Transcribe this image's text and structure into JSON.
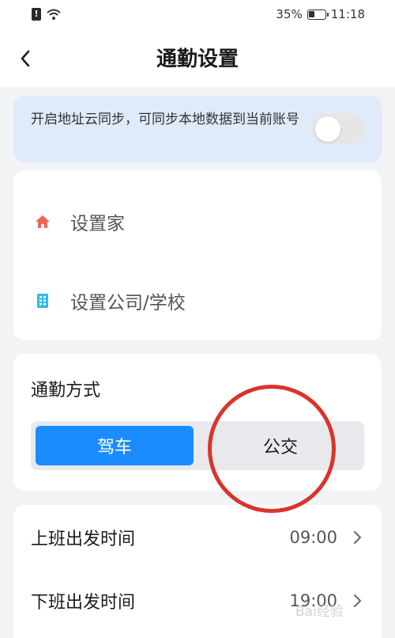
{
  "status_bar": {
    "sim_icon": "sim-alert-icon",
    "wifi_icon": "wifi-icon",
    "battery_percent": "35%",
    "battery_level": 0.35,
    "time": "11:18"
  },
  "header": {
    "back_icon": "chevron-left-icon",
    "title": "通勤设置"
  },
  "sync": {
    "text": "开启地址云同步，可同步本地数据到当前账号",
    "toggle_on": false
  },
  "addresses": {
    "home": {
      "icon": "home-icon",
      "label": "设置家"
    },
    "work": {
      "icon": "building-icon",
      "label": "设置公司/学校"
    }
  },
  "commute": {
    "title": "通勤方式",
    "options": [
      "驾车",
      "公交"
    ],
    "selected": "驾车"
  },
  "times": [
    {
      "label": "上班出发时间",
      "value": "09:00"
    },
    {
      "label": "下班出发时间",
      "value": "19:00"
    }
  ],
  "watermark": "Bai经验",
  "colors": {
    "accent": "#1a8cff",
    "banner_bg": "#dfeafb",
    "annotation": "#d9342b",
    "home_icon": "#f0645a",
    "building_icon": "#2ebde8"
  }
}
